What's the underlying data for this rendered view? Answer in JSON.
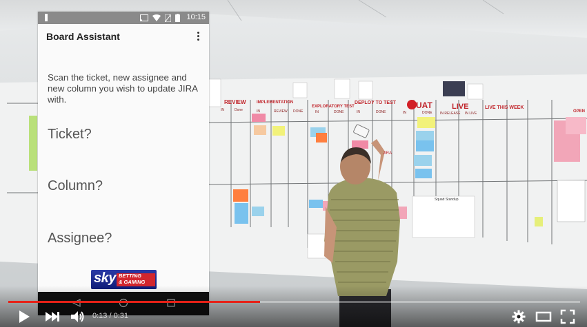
{
  "phone": {
    "status_time": "10:15",
    "app_title": "Board Assistant",
    "instructions": "Scan the ticket, new assignee and new column you wish to update JIRA with.",
    "prompts": {
      "ticket": "Ticket?",
      "column": "Column?",
      "assignee": "Assignee?"
    },
    "logo": {
      "sky": "sky",
      "line1": "BETTING",
      "line2": "& GAMING"
    }
  },
  "board": {
    "headers": [
      "REVIEW",
      "IMPLEMENTATION",
      "EXPLORATORY TEST",
      "DEPLOY TO TEST",
      "UAT",
      "LIVE",
      "LIVE THIS WEEK",
      "OPEN"
    ],
    "subheaders": [
      "IN",
      "Done",
      "IN",
      "REVIEW",
      "DONE",
      "IN",
      "DONE",
      "IN",
      "DONE",
      "IN",
      "DONE",
      "IN RELEASE",
      "IN LIVE"
    ],
    "standup_title": "Squad Standup"
  },
  "player": {
    "time_current": "0:13",
    "time_total": "0:31",
    "time_separator": " / ",
    "played_fraction": 0.44,
    "buffered_fraction": 0.44,
    "accent_color": "#e62117"
  }
}
